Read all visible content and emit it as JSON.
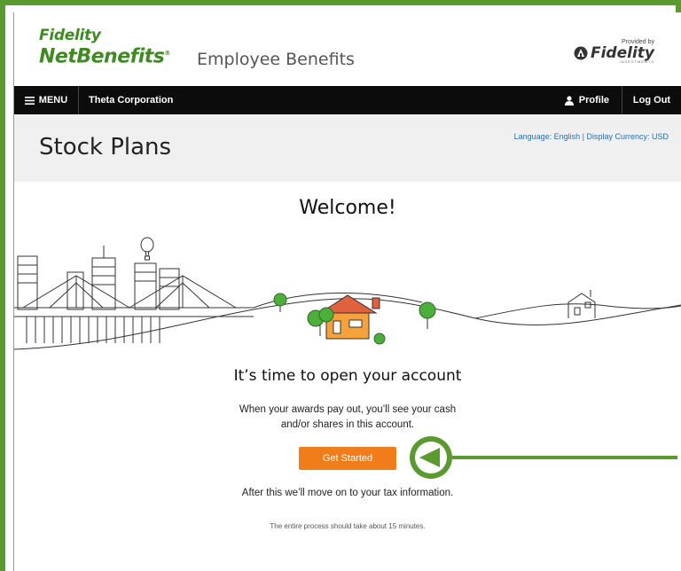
{
  "header": {
    "brand_line1": "Fidelity",
    "brand_line2": "NetBenefits",
    "brand_reg": "®",
    "brand_subtitle": "Employee Benefits",
    "provided_by": "Provided by",
    "provider_name": "Fidelity",
    "provider_sub": "INVESTMENTS"
  },
  "nav": {
    "menu_label": "MENU",
    "company": "Theta Corporation",
    "profile_label": "Profile",
    "logout_label": "Log Out"
  },
  "page": {
    "title": "Stock Plans",
    "language_label": "Language: English | Display Currency: USD"
  },
  "main": {
    "welcome": "Welcome!",
    "heading": "It’s time to open your account",
    "description_line1": "When your awards pay out, you’ll see your cash",
    "description_line2": "and/or shares in this account.",
    "button_label": "Get Started",
    "after_text": "After this we’ll move on to your tax information.",
    "process_text": "The entire process should take about 15 minutes."
  },
  "colors": {
    "brand_green": "#3f8a22",
    "callout_green": "#5a9a2e",
    "button_orange": "#f07d1a",
    "nav_black": "#0c0c0c",
    "link_blue": "#2a6fb0"
  },
  "icons": {
    "menu": "hamburger-icon",
    "profile": "person-icon",
    "callout": "arrow-pointer-icon"
  }
}
